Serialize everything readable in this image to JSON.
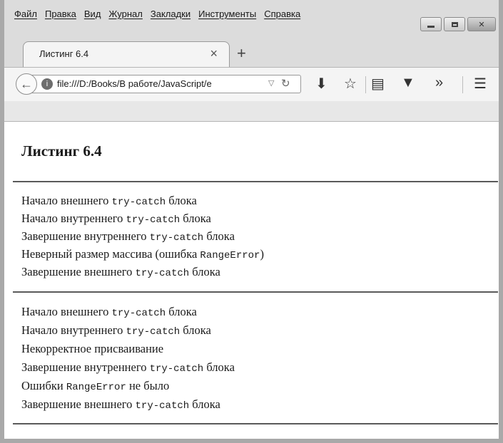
{
  "menu": [
    "Файл",
    "Правка",
    "Вид",
    "Журнал",
    "Закладки",
    "Инструменты",
    "Справка"
  ],
  "tab": {
    "title": "Листинг 6.4",
    "close": "×",
    "new_tab": "+"
  },
  "address": {
    "url": "file:///D:/Books/В работе/JavaScript/e"
  },
  "page": {
    "title": "Листинг 6.4",
    "block1": [
      {
        "pre": "Начало внешнего ",
        "code": "try-catch",
        "post": " блока"
      },
      {
        "pre": "Начало внутреннего ",
        "code": "try-catch",
        "post": " блока"
      },
      {
        "pre": "Завершение внутреннего ",
        "code": "try-catch",
        "post": " блока"
      },
      {
        "pre": "Неверный размер массива (ошибка ",
        "code": "RangeError",
        "post": ")"
      },
      {
        "pre": "Завершение внешнего ",
        "code": "try-catch",
        "post": " блока"
      }
    ],
    "block2": [
      {
        "pre": "Начало внешнего ",
        "code": "try-catch",
        "post": " блока"
      },
      {
        "pre": "Начало внутреннего ",
        "code": "try-catch",
        "post": " блока"
      },
      {
        "pre": "Некорректное присваивание",
        "code": "",
        "post": ""
      },
      {
        "pre": "Завершение внутреннего ",
        "code": "try-catch",
        "post": " блока"
      },
      {
        "pre": "Ошибки ",
        "code": "RangeError",
        "post": " не было"
      },
      {
        "pre": "Завершение внешнего ",
        "code": "try-catch",
        "post": " блока"
      }
    ]
  }
}
